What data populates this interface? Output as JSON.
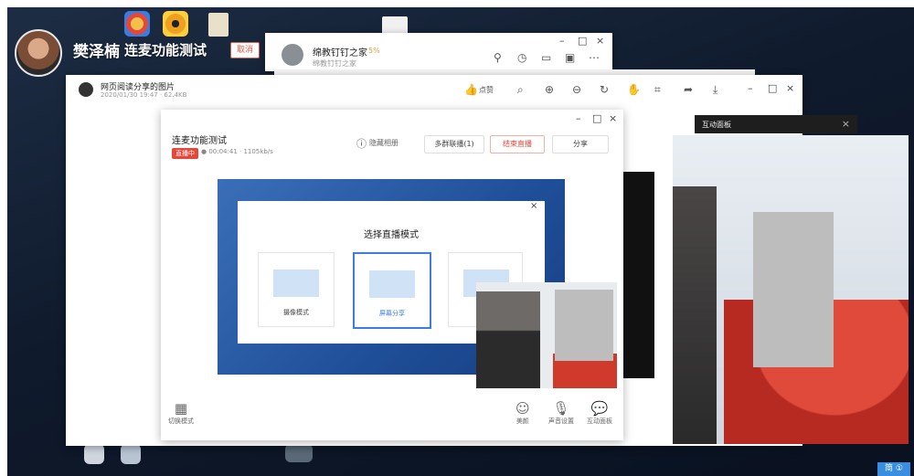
{
  "presenter": {
    "name": "樊泽楠",
    "status": "连麦功能测试",
    "cancel_label": "取消"
  },
  "chat_window": {
    "contact": "绵教钉钉之家",
    "tag": "5%",
    "sub": "绵教钉钉之家"
  },
  "viewer": {
    "title": "网页阅读分享的图片",
    "meta": "2020/01/30 19:47 · 62.4KB",
    "like_label": "点赞"
  },
  "live": {
    "title": "连麦功能测试",
    "badge": "直播中",
    "stats": "● 00:04:41 · 1105kb/s",
    "hide_hint": "隐藏相册",
    "multi_label": "多群联播(1)",
    "end_label": "结束直播",
    "share_label": "分享"
  },
  "mode_dialog": {
    "title": "选择直播模式",
    "modes": [
      {
        "label": "摄像模式"
      },
      {
        "label": "屏幕分享"
      }
    ]
  },
  "bottom_controls": {
    "switch_mode": "切换模式",
    "beauty": "美颜",
    "sound": "声音设置",
    "interaction": "互动面板"
  },
  "panel": {
    "title": "互动面板"
  },
  "corner": {
    "label": "简 ①"
  }
}
